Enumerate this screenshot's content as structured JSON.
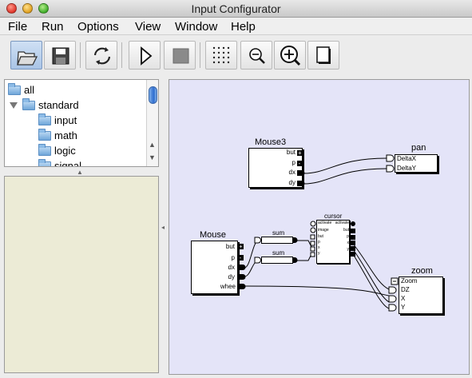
{
  "window": {
    "title": "Input Configurator"
  },
  "menu": [
    "File",
    "Run",
    "Options",
    "View",
    "Window",
    "Help"
  ],
  "toolbar": {
    "buttons": [
      "open-folder-icon",
      "save-icon",
      "refresh-icon",
      "play-icon",
      "stop-icon",
      "grid-icon",
      "zoom-out-icon",
      "zoom-in-icon",
      "page-icon"
    ],
    "active": "open-folder-icon"
  },
  "tree": {
    "root": "all",
    "standard": "standard",
    "children": [
      "input",
      "math",
      "logic",
      "signal"
    ]
  },
  "nodes": {
    "mouse3": {
      "title": "Mouse3",
      "ports": [
        "but",
        "p",
        "dx",
        "dy"
      ]
    },
    "pan": {
      "title": "pan",
      "ports": [
        "DeltaX",
        "DeltaY"
      ]
    },
    "mouse": {
      "title": "Mouse",
      "ports": [
        "but",
        "p",
        "dx",
        "dy",
        "whee"
      ]
    },
    "sum1": {
      "title": "sum"
    },
    "sum2": {
      "title": "sum"
    },
    "cursor": {
      "title": "cursor",
      "inputs": [
        "activate",
        "image",
        "but",
        "p",
        "x",
        "y"
      ],
      "outputs": [
        "activate",
        "but",
        "p",
        "x",
        "y"
      ]
    },
    "zoom": {
      "title": "zoom",
      "ports": [
        "Zoom",
        "DZ",
        "X",
        "Y"
      ]
    }
  },
  "colors": {
    "canvas": "#e4e4f8",
    "lower_panel": "#ecebd6",
    "selection": "#a9c4e6"
  }
}
